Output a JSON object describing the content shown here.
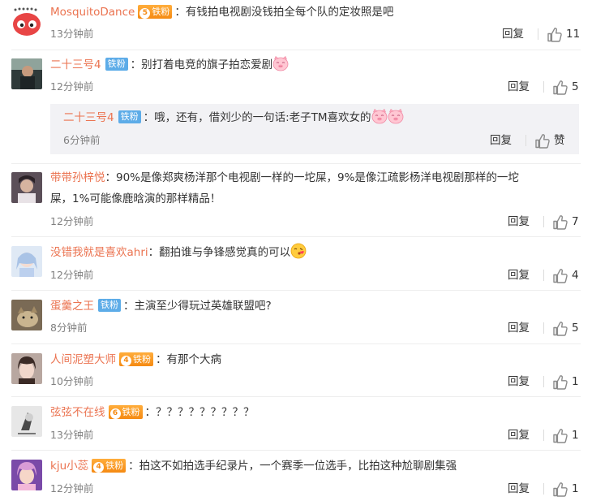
{
  "comments": [
    {
      "user": "MosquitoDance",
      "badge": "铁粉",
      "badge_level": "5",
      "text": "有钱拍电视剧没钱拍全每个队的定妆照是吧",
      "time": "13分钟前",
      "reply": "回复",
      "likes": "11"
    },
    {
      "user": "二十三号4",
      "badge": "铁粉",
      "text": "别打着电竞的旗子拍恋爱剧",
      "time": "12分钟前",
      "reply": "回复",
      "likes": "5",
      "sub": {
        "user": "二十三号4",
        "badge": "铁粉",
        "text": "哦，还有，借刘少的一句话:老子TM喜欢女的",
        "time": "6分钟前",
        "reply": "回复",
        "likes": "赞"
      }
    },
    {
      "user": "带带孙梓悦",
      "text_line1": "90%是像郑爽杨洋那个电视剧一样的一坨屎，9%是像江疏影杨洋电视剧那样的一坨",
      "text_line2": "屎，1%可能像鹿晗演的那样精品！",
      "time": "12分钟前",
      "reply": "回复",
      "likes": "7"
    },
    {
      "user": "没错我就是喜欢ahri",
      "text": "翻拍谁与争锋感觉真的可以",
      "time": "12分钟前",
      "reply": "回复",
      "likes": "4"
    },
    {
      "user": "蛋羹之王",
      "badge": "铁粉",
      "text": "主演至少得玩过英雄联盟吧?",
      "time": "8分钟前",
      "reply": "回复",
      "likes": "5"
    },
    {
      "user": "人间泥塑大师",
      "badge": "铁粉",
      "badge_level": "4",
      "text": "有那个大病",
      "time": "10分钟前",
      "reply": "回复",
      "likes": "1"
    },
    {
      "user": "弦弦不在线",
      "badge": "铁粉",
      "badge_level": "6",
      "text": "？？？？？？？？？",
      "time": "13分钟前",
      "reply": "回复",
      "likes": "1"
    },
    {
      "user": "kju小蕊",
      "badge": "铁粉",
      "badge_level": "4",
      "text": "拍这不如拍选手纪录片，一个赛季一位选手，比拍这种尬聊剧集强",
      "time": "12分钟前",
      "reply": "回复",
      "likes": "1"
    }
  ],
  "colon": "：",
  "icons": {
    "like": "thumbs-up-icon",
    "emoji_pig": "pig-face-emoji",
    "emoji_kiss": "kiss-face-emoji"
  },
  "colors": {
    "username": "#eb7350",
    "badge": "#5dace8",
    "vip": "#f58a12",
    "subbox": "#f2f2f5",
    "time": "#808080"
  }
}
